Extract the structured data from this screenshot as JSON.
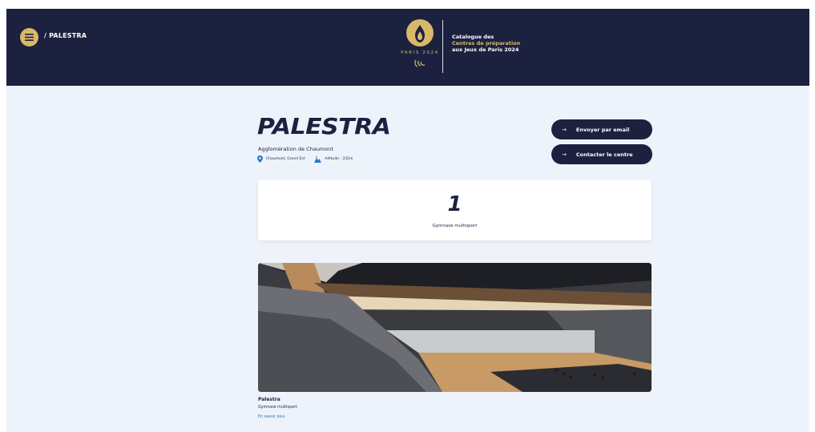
{
  "header": {
    "breadcrumb": "/ PALESTRA",
    "logo": {
      "text": "PARIS 2024",
      "brand_color": "#d9b86a"
    },
    "catalog": {
      "line1": "Catalogue des",
      "line2": "Centres de préparation",
      "line3": "aux Jeux de Paris 2024"
    },
    "background": "#1d2140"
  },
  "venue": {
    "title": "PALESTRA",
    "subtitle": "Agglomération de Chaumont",
    "location": "Chaumont, Grand Est",
    "altitude": "Altitude : 332m"
  },
  "actions": {
    "email_label": "Envoyer par email",
    "contact_label": "Contacter le centre",
    "arrow": "→"
  },
  "stats": {
    "value": "1",
    "label": "Gymnase multisport"
  },
  "facility_card": {
    "title": "Palestra",
    "subtitle": "Gymnase multisport",
    "link": "En savoir plus"
  },
  "icons": {
    "menu": "menu-icon",
    "location": "location-pin-icon",
    "altitude": "mountain-icon"
  }
}
